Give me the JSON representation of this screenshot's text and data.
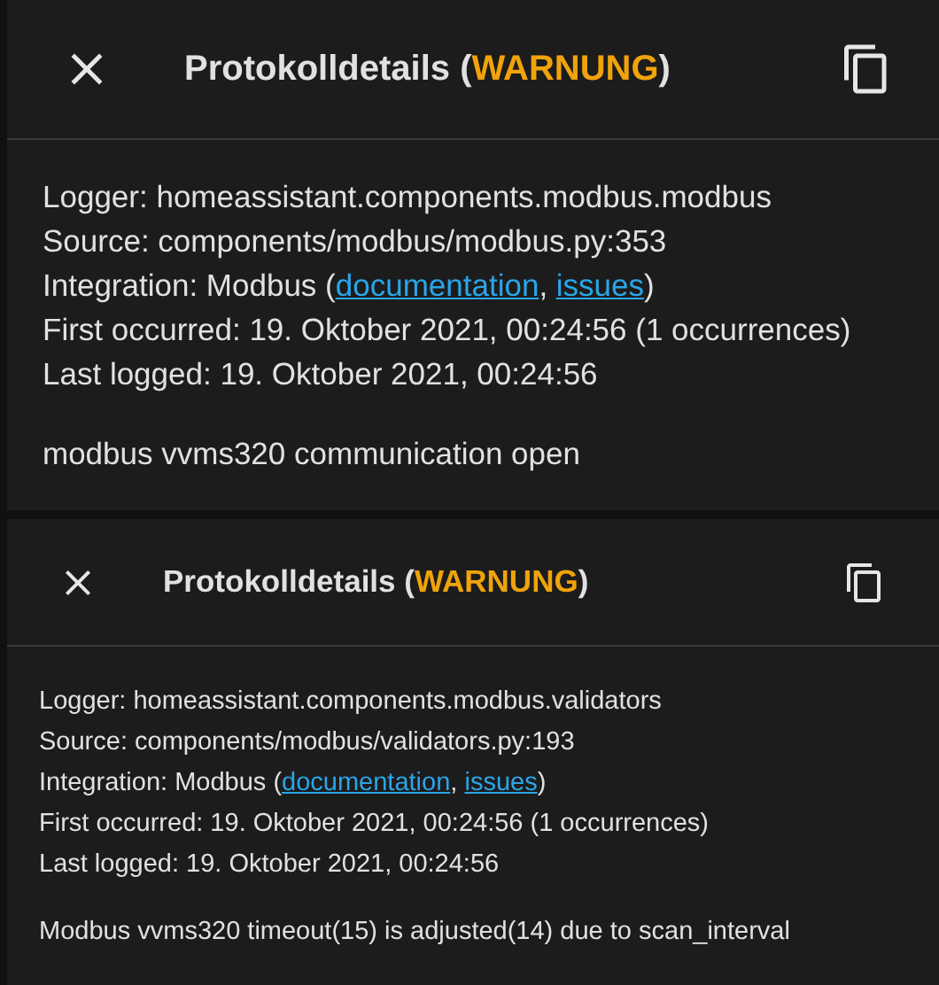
{
  "dialogs": [
    {
      "title": [
        {
          "kind": "text",
          "text": "Protokolldetails ("
        },
        {
          "kind": "severity",
          "text": "WARNUNG"
        },
        {
          "kind": "text",
          "text": ")"
        }
      ],
      "details": [
        [
          {
            "kind": "text",
            "text": "Logger: homeassistant.components.modbus.modbus"
          }
        ],
        [
          {
            "kind": "text",
            "text": "Source: components/modbus/modbus.py:353"
          }
        ],
        [
          {
            "kind": "text",
            "text": "Integration: Modbus ("
          },
          {
            "kind": "link",
            "text": "documentation"
          },
          {
            "kind": "link",
            "prefix": ", ",
            "text": "issues"
          },
          {
            "kind": "text",
            "text": ")"
          }
        ],
        [
          {
            "kind": "text",
            "text": "First occurred: 19. Oktober 2021, 00:24:56 (1 occurrences)"
          }
        ],
        [
          {
            "kind": "text",
            "text": "Last logged: 19. Oktober 2021, 00:24:56"
          }
        ]
      ],
      "message": "modbus vvms320 communication open"
    },
    {
      "title": [
        {
          "kind": "text",
          "text": "Protokolldetails ("
        },
        {
          "kind": "severity",
          "text": "WARNUNG"
        },
        {
          "kind": "text",
          "text": ")"
        }
      ],
      "details": [
        [
          {
            "kind": "text",
            "text": "Logger: homeassistant.components.modbus.validators"
          }
        ],
        [
          {
            "kind": "text",
            "text": "Source: components/modbus/validators.py:193"
          }
        ],
        [
          {
            "kind": "text",
            "text": "Integration: Modbus ("
          },
          {
            "kind": "link",
            "text": "documentation"
          },
          {
            "kind": "link",
            "prefix": ", ",
            "text": "issues"
          },
          {
            "kind": "text",
            "text": ")"
          }
        ],
        [
          {
            "kind": "text",
            "text": "First occurred: 19. Oktober 2021, 00:24:56 (1 occurrences)"
          }
        ],
        [
          {
            "kind": "text",
            "text": "Last logged: 19. Oktober 2021, 00:24:56"
          }
        ]
      ],
      "message": "Modbus vvms320 timeout(15) is adjusted(14) due to scan_interval"
    }
  ]
}
